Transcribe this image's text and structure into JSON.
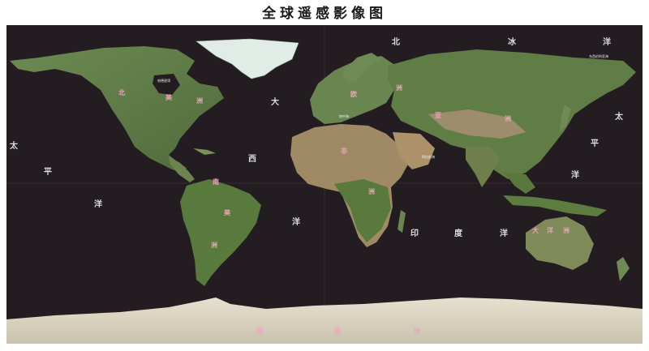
{
  "title": "全球遥感影像图",
  "oceans": {
    "pacific_west_1": "太",
    "pacific_west_2": "平",
    "pacific_west_3": "洋",
    "pacific_east_1": "太",
    "pacific_east_2": "平",
    "pacific_east_3": "洋",
    "atlantic_1": "大",
    "atlantic_2": "西",
    "atlantic_3": "洋",
    "arctic_1": "北",
    "arctic_2": "冰",
    "arctic_3": "洋",
    "indian_1": "印",
    "indian_2": "度",
    "indian_3": "洋"
  },
  "continents": {
    "north_america": [
      "北",
      "美",
      "洲"
    ],
    "south_america": [
      "南",
      "美",
      "洲"
    ],
    "europe": [
      "欧",
      "洲"
    ],
    "africa": [
      "非",
      "洲"
    ],
    "asia": [
      "亚",
      "洲"
    ],
    "oceania": [
      "大",
      "洋",
      "洲"
    ],
    "antarctica": [
      "南",
      "极",
      "洲"
    ]
  },
  "places": {
    "hudson_bay": "哈德逊湾",
    "east_siberian_sea": "东西伯利亚海",
    "arabian_sea": "阿拉伯海",
    "mediterranean": "地中海"
  },
  "colors": {
    "ocean": "#231c20",
    "land": "#5e7a45",
    "desert": "#a88f6a",
    "ice": "#ddd6c4",
    "continent_label": "#f2a0c0"
  }
}
